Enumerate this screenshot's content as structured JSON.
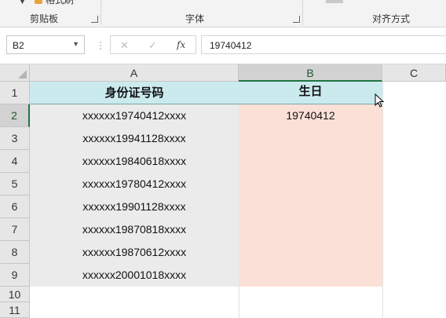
{
  "ribbon": {
    "partial_label": "格式刷",
    "groups": [
      {
        "label": "剪贴板"
      },
      {
        "label": "字体"
      },
      {
        "label": "对齐方式"
      }
    ]
  },
  "formula_bar": {
    "name_box": "B2",
    "formula_value": "19740412",
    "fx_label": "fx",
    "cancel_glyph": "✕",
    "enter_glyph": "✓"
  },
  "sheet": {
    "columns": [
      "A",
      "B",
      "C"
    ],
    "row_numbers": [
      "1",
      "2",
      "3",
      "4",
      "5",
      "6",
      "7",
      "8",
      "9",
      "10",
      "11"
    ],
    "header_row": {
      "a": "身份证号码",
      "b": "生日"
    },
    "rows": [
      {
        "a": "xxxxxx19740412xxxx",
        "b": "19740412"
      },
      {
        "a": "xxxxxx19941128xxxx",
        "b": ""
      },
      {
        "a": "xxxxxx19840618xxxx",
        "b": ""
      },
      {
        "a": "xxxxxx19780412xxxx",
        "b": ""
      },
      {
        "a": "xxxxxx19901128xxxx",
        "b": ""
      },
      {
        "a": "xxxxxx19870818xxxx",
        "b": ""
      },
      {
        "a": "xxxxxx19870612xxxx",
        "b": ""
      },
      {
        "a": "xxxxxx20001018xxxx",
        "b": ""
      }
    ]
  },
  "colors": {
    "header_fill": "#cbeaee",
    "birthday_fill": "#fbe0d7",
    "selection_accent": "#217346"
  }
}
